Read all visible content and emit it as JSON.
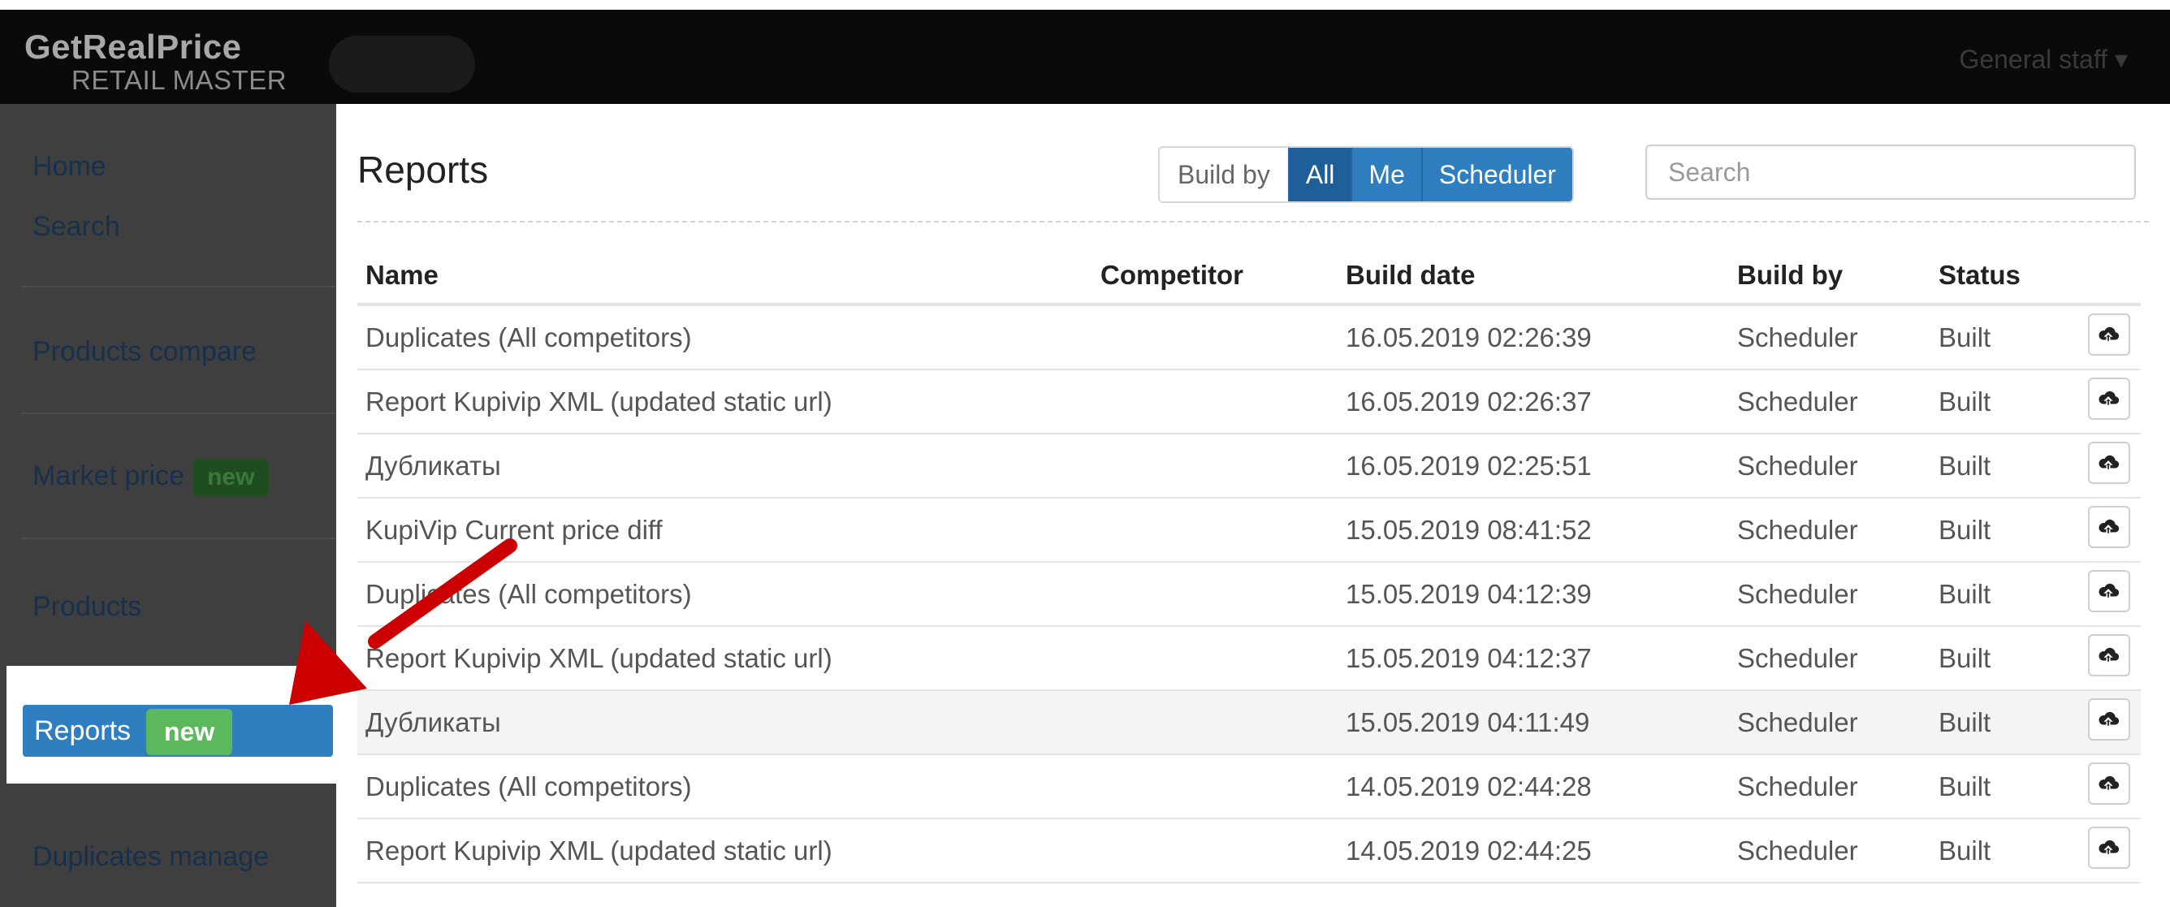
{
  "brand": {
    "name": "GetRealPrice",
    "sub": "RETAIL MASTER"
  },
  "user_menu": "General staff ▾",
  "sidebar": {
    "home": "Home",
    "search": "Search",
    "products_compare": "Products compare",
    "market_price": "Market price",
    "market_price_badge": "new",
    "products": "Products",
    "reports": "Reports",
    "reports_badge": "new",
    "duplicates_manage": "Duplicates manage"
  },
  "main": {
    "title": "Reports",
    "build_by_label": "Build by",
    "filters": [
      "All",
      "Me",
      "Scheduler"
    ],
    "search_placeholder": "Search"
  },
  "table": {
    "headers": {
      "name": "Name",
      "competitor": "Competitor",
      "build_date": "Build date",
      "build_by": "Build by",
      "status": "Status"
    },
    "rows": [
      {
        "name": "Duplicates (All competitors)",
        "competitor": "",
        "date": "16.05.2019 02:26:39",
        "by": "Scheduler",
        "status": "Built"
      },
      {
        "name": "Report Kupivip XML (updated static url)",
        "competitor": "",
        "date": "16.05.2019 02:26:37",
        "by": "Scheduler",
        "status": "Built"
      },
      {
        "name": "Дубликаты",
        "competitor": "",
        "date": "16.05.2019 02:25:51",
        "by": "Scheduler",
        "status": "Built"
      },
      {
        "name": "KupiVip Current price diff",
        "competitor": "",
        "date": "15.05.2019 08:41:52",
        "by": "Scheduler",
        "status": "Built"
      },
      {
        "name": "Duplicates (All competitors)",
        "competitor": "",
        "date": "15.05.2019 04:12:39",
        "by": "Scheduler",
        "status": "Built"
      },
      {
        "name": "Report Kupivip XML (updated static url)",
        "competitor": "",
        "date": "15.05.2019 04:12:37",
        "by": "Scheduler",
        "status": "Built"
      },
      {
        "name": "Дубликаты",
        "competitor": "",
        "date": "15.05.2019 04:11:49",
        "by": "Scheduler",
        "status": "Built"
      },
      {
        "name": "Duplicates (All competitors)",
        "competitor": "",
        "date": "14.05.2019 02:44:28",
        "by": "Scheduler",
        "status": "Built"
      },
      {
        "name": "Report Kupivip XML (updated static url)",
        "competitor": "",
        "date": "14.05.2019 02:44:25",
        "by": "Scheduler",
        "status": "Built"
      }
    ]
  },
  "icons": {
    "download": "cloud-download-icon"
  },
  "colors": {
    "accent": "#2f7fc0",
    "badge_green": "#5cb85c",
    "arrow": "#cc0000"
  }
}
